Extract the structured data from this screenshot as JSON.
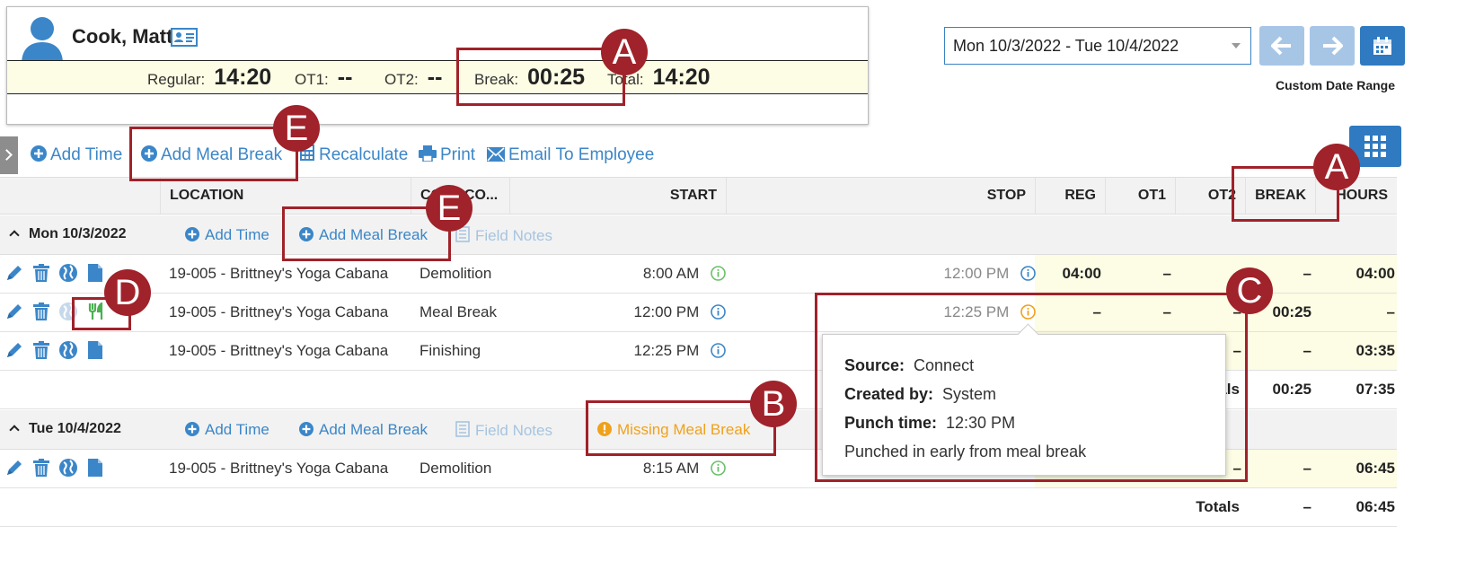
{
  "employee": {
    "name": "Cook, Matt",
    "icons": {
      "avatar": "person-silhouette-icon",
      "card": "id-card-icon"
    }
  },
  "summary": {
    "regular_label": "Regular:",
    "regular_value": "14:20",
    "ot1_label": "OT1:",
    "ot1_value": "--",
    "ot2_label": "OT2:",
    "ot2_value": "--",
    "break_label": "Break:",
    "break_value": "00:25",
    "total_label": "Total:",
    "total_value": "14:20"
  },
  "date_range": {
    "value": "Mon 10/3/2022 - Tue 10/4/2022",
    "custom_label": "Custom Date Range"
  },
  "toolbar": {
    "add_time": "Add Time",
    "add_meal_break": "Add Meal Break",
    "recalculate": "Recalculate",
    "print": "Print",
    "email": "Email To Employee"
  },
  "columns": {
    "location": "LOCATION",
    "cost_code": "COST CO...",
    "start": "START",
    "stop": "STOP",
    "reg": "REG",
    "ot1": "OT1",
    "ot2": "OT2",
    "break": "BREAK",
    "hours": "HOURS"
  },
  "day1": {
    "title": "Mon 10/3/2022",
    "add_time": "Add Time",
    "add_meal_break": "Add Meal Break",
    "field_notes": "Field Notes",
    "rows": [
      {
        "location": "19-005 - Brittney's Yoga Cabana",
        "cost_code": "Demolition",
        "start": "8:00 AM",
        "stop": "12:00 PM",
        "reg": "04:00",
        "ot1": "–",
        "ot2": "–",
        "break": "–",
        "hours": "04:00"
      },
      {
        "location": "19-005 - Brittney's Yoga Cabana",
        "cost_code": "Meal Break",
        "start": "12:00 PM",
        "stop": "12:25 PM",
        "reg": "–",
        "ot1": "–",
        "ot2": "–",
        "break": "00:25",
        "hours": "–"
      },
      {
        "location": "19-005 - Brittney's Yoga Cabana",
        "cost_code": "Finishing",
        "start": "12:25 PM",
        "stop": "",
        "reg": "",
        "ot1": "",
        "ot2": "–",
        "break": "–",
        "hours": "03:35"
      }
    ],
    "totals_label": "Totals",
    "totals_break": "00:25",
    "totals_hours": "07:35"
  },
  "day2": {
    "title": "Tue 10/4/2022",
    "add_time": "Add Time",
    "add_meal_break": "Add Meal Break",
    "field_notes": "Field Notes",
    "missing_meal_break": "Missing Meal Break",
    "rows": [
      {
        "location": "19-005 - Brittney's Yoga Cabana",
        "cost_code": "Demolition",
        "start": "8:15 AM",
        "ot2": "–",
        "break": "–",
        "hours": "06:45"
      }
    ],
    "totals_label": "Totals",
    "totals_break": "–",
    "totals_hours": "06:45"
  },
  "popover": {
    "source_label": "Source:",
    "source_value": "Connect",
    "created_label": "Created by:",
    "created_value": "System",
    "punch_label": "Punch time:",
    "punch_value": "12:30 PM",
    "note": "Punched in early from meal break"
  },
  "callouts": {
    "a": "A",
    "b": "B",
    "c": "C",
    "d": "D",
    "e": "E"
  },
  "colors": {
    "link": "#3b86c8",
    "callout": "#a0222a",
    "warning": "#f0a11c",
    "highlight_bg": "#fdfce4",
    "primary_button": "#2f7ac0"
  }
}
